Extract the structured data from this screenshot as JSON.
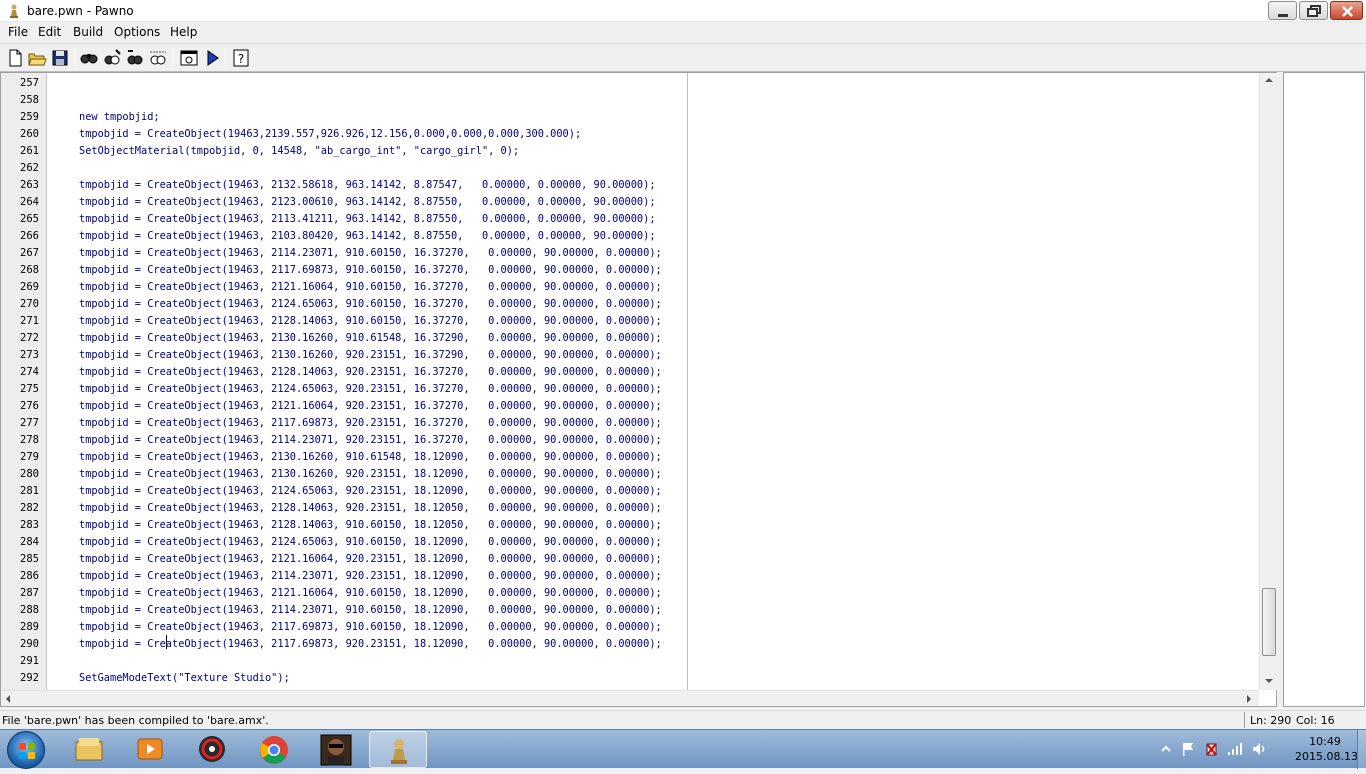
{
  "window": {
    "title": "bare.pwn - Pawno"
  },
  "menu": [
    "File",
    "Edit",
    "Build",
    "Options",
    "Help"
  ],
  "toolbar": {
    "icons": [
      "new-file-icon",
      "open-file-icon",
      "save-icon",
      "find-icon",
      "find-next-icon",
      "replace-icon",
      "goto-line-icon",
      "compile-icon",
      "run-icon",
      "help-icon"
    ]
  },
  "editor": {
    "lines": [
      {
        "num": "257",
        "code": ""
      },
      {
        "num": "258",
        "code": ""
      },
      {
        "num": "259",
        "code": "new tmpobjid;"
      },
      {
        "num": "260",
        "code": "tmpobjid = CreateObject(19463,2139.557,926.926,12.156,0.000,0.000,0.000,300.000);"
      },
      {
        "num": "261",
        "code": "SetObjectMaterial(tmpobjid, 0, 14548, \"ab_cargo_int\", \"cargo_girl\", 0);"
      },
      {
        "num": "262",
        "code": ""
      },
      {
        "num": "263",
        "code": "tmpobjid = CreateObject(19463, 2132.58618, 963.14142, 8.87547,   0.00000, 0.00000, 90.00000);"
      },
      {
        "num": "264",
        "code": "tmpobjid = CreateObject(19463, 2123.00610, 963.14142, 8.87550,   0.00000, 0.00000, 90.00000);"
      },
      {
        "num": "265",
        "code": "tmpobjid = CreateObject(19463, 2113.41211, 963.14142, 8.87550,   0.00000, 0.00000, 90.00000);"
      },
      {
        "num": "266",
        "code": "tmpobjid = CreateObject(19463, 2103.80420, 963.14142, 8.87550,   0.00000, 0.00000, 90.00000);"
      },
      {
        "num": "267",
        "code": "tmpobjid = CreateObject(19463, 2114.23071, 910.60150, 16.37270,   0.00000, 90.00000, 0.00000);"
      },
      {
        "num": "268",
        "code": "tmpobjid = CreateObject(19463, 2117.69873, 910.60150, 16.37270,   0.00000, 90.00000, 0.00000);"
      },
      {
        "num": "269",
        "code": "tmpobjid = CreateObject(19463, 2121.16064, 910.60150, 16.37270,   0.00000, 90.00000, 0.00000);"
      },
      {
        "num": "270",
        "code": "tmpobjid = CreateObject(19463, 2124.65063, 910.60150, 16.37270,   0.00000, 90.00000, 0.00000);"
      },
      {
        "num": "271",
        "code": "tmpobjid = CreateObject(19463, 2128.14063, 910.60150, 16.37270,   0.00000, 90.00000, 0.00000);"
      },
      {
        "num": "272",
        "code": "tmpobjid = CreateObject(19463, 2130.16260, 910.61548, 16.37290,   0.00000, 90.00000, 0.00000);"
      },
      {
        "num": "273",
        "code": "tmpobjid = CreateObject(19463, 2130.16260, 920.23151, 16.37290,   0.00000, 90.00000, 0.00000);"
      },
      {
        "num": "274",
        "code": "tmpobjid = CreateObject(19463, 2128.14063, 920.23151, 16.37270,   0.00000, 90.00000, 0.00000);"
      },
      {
        "num": "275",
        "code": "tmpobjid = CreateObject(19463, 2124.65063, 920.23151, 16.37270,   0.00000, 90.00000, 0.00000);"
      },
      {
        "num": "276",
        "code": "tmpobjid = CreateObject(19463, 2121.16064, 920.23151, 16.37270,   0.00000, 90.00000, 0.00000);"
      },
      {
        "num": "277",
        "code": "tmpobjid = CreateObject(19463, 2117.69873, 920.23151, 16.37270,   0.00000, 90.00000, 0.00000);"
      },
      {
        "num": "278",
        "code": "tmpobjid = CreateObject(19463, 2114.23071, 920.23151, 16.37270,   0.00000, 90.00000, 0.00000);"
      },
      {
        "num": "279",
        "code": "tmpobjid = CreateObject(19463, 2130.16260, 910.61548, 18.12090,   0.00000, 90.00000, 0.00000);"
      },
      {
        "num": "280",
        "code": "tmpobjid = CreateObject(19463, 2130.16260, 920.23151, 18.12090,   0.00000, 90.00000, 0.00000);"
      },
      {
        "num": "281",
        "code": "tmpobjid = CreateObject(19463, 2124.65063, 920.23151, 18.12090,   0.00000, 90.00000, 0.00000);"
      },
      {
        "num": "282",
        "code": "tmpobjid = CreateObject(19463, 2128.14063, 920.23151, 18.12050,   0.00000, 90.00000, 0.00000);"
      },
      {
        "num": "283",
        "code": "tmpobjid = CreateObject(19463, 2128.14063, 910.60150, 18.12050,   0.00000, 90.00000, 0.00000);"
      },
      {
        "num": "284",
        "code": "tmpobjid = CreateObject(19463, 2124.65063, 910.60150, 18.12090,   0.00000, 90.00000, 0.00000);"
      },
      {
        "num": "285",
        "code": "tmpobjid = CreateObject(19463, 2121.16064, 920.23151, 18.12090,   0.00000, 90.00000, 0.00000);"
      },
      {
        "num": "286",
        "code": "tmpobjid = CreateObject(19463, 2114.23071, 920.23151, 18.12090,   0.00000, 90.00000, 0.00000);"
      },
      {
        "num": "287",
        "code": "tmpobjid = CreateObject(19463, 2121.16064, 910.60150, 18.12090,   0.00000, 90.00000, 0.00000);"
      },
      {
        "num": "288",
        "code": "tmpobjid = CreateObject(19463, 2114.23071, 910.60150, 18.12090,   0.00000, 90.00000, 0.00000);"
      },
      {
        "num": "289",
        "code": "tmpobjid = CreateObject(19463, 2117.69873, 910.60150, 18.12090,   0.00000, 90.00000, 0.00000);"
      },
      {
        "num": "290",
        "code": "tmpobjid = CreateObject(19463, 2117.69873, 920.23151, 18.12090,   0.00000, 90.00000, 0.00000);"
      },
      {
        "num": "291",
        "code": ""
      },
      {
        "num": "292",
        "code": "SetGameModeText(\"Texture Studio\");"
      }
    ]
  },
  "status": {
    "message": "File 'bare.pwn' has been compiled to 'bare.amx'.",
    "line": "Ln: 290",
    "col": "Col: 16"
  },
  "taskbar": {
    "time": "10:49",
    "date": "2015.08.13",
    "apps": [
      "explorer-icon",
      "media-player-icon",
      "sync-app-icon",
      "chrome-icon",
      "game-icon",
      "pawno-icon"
    ]
  }
}
